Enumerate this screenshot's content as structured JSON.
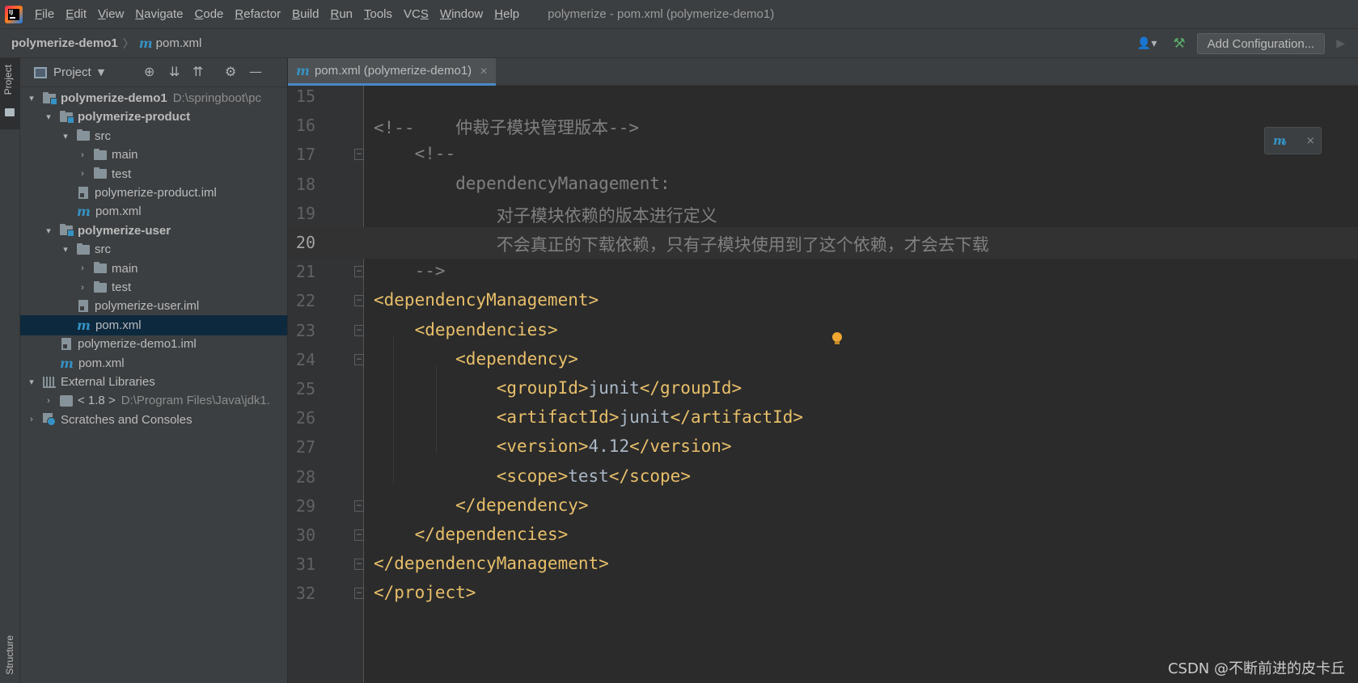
{
  "menubar": {
    "items": [
      {
        "label": "File",
        "mnemonic": "F",
        "rest": "ile"
      },
      {
        "label": "Edit",
        "mnemonic": "E",
        "rest": "dit"
      },
      {
        "label": "View",
        "mnemonic": "V",
        "rest": "iew"
      },
      {
        "label": "Navigate",
        "mnemonic": "N",
        "rest": "avigate"
      },
      {
        "label": "Code",
        "mnemonic": "C",
        "rest": "ode"
      },
      {
        "label": "Refactor",
        "mnemonic": "R",
        "rest": "efactor"
      },
      {
        "label": "Build",
        "mnemonic": "B",
        "rest": "uild"
      },
      {
        "label": "Run",
        "mnemonic": "R",
        "rest": "un"
      },
      {
        "label": "Tools",
        "mnemonic": "T",
        "rest": "ools"
      },
      {
        "label": "VCS",
        "mnemonic": "S",
        "rest": "VC"
      },
      {
        "label": "Window",
        "mnemonic": "W",
        "rest": "indow"
      },
      {
        "label": "Help",
        "mnemonic": "H",
        "rest": "elp"
      }
    ],
    "window_title": "polymerize - pom.xml (polymerize-demo1)"
  },
  "navbar": {
    "project": "polymerize-demo1",
    "separator": "〉",
    "file_icon": "m",
    "file": "pom.xml",
    "add_configuration": "Add Configuration..."
  },
  "left_strip": {
    "project_label": "Project",
    "structure_label": "Structure"
  },
  "project_panel": {
    "title": "Project",
    "tree": [
      {
        "label": "polymerize-demo1",
        "path": "D:\\springboot\\pc",
        "icon": "module-folder",
        "arrow": "▾",
        "bold": true
      },
      {
        "label": "polymerize-product",
        "icon": "module-folder",
        "arrow": "▾",
        "bold": true
      },
      {
        "label": "src",
        "icon": "folder",
        "arrow": "▾"
      },
      {
        "label": "main",
        "icon": "folder",
        "arrow": "›"
      },
      {
        "label": "test",
        "icon": "folder",
        "arrow": "›"
      },
      {
        "label": "polymerize-product.iml",
        "icon": "iml-file"
      },
      {
        "label": "pom.xml",
        "icon": "maven-file"
      },
      {
        "label": "polymerize-user",
        "icon": "module-folder",
        "arrow": "▾",
        "bold": true
      },
      {
        "label": "src",
        "icon": "folder",
        "arrow": "▾"
      },
      {
        "label": "main",
        "icon": "folder",
        "arrow": "›"
      },
      {
        "label": "test",
        "icon": "folder",
        "arrow": "›"
      },
      {
        "label": "polymerize-user.iml",
        "icon": "iml-file"
      },
      {
        "label": "pom.xml",
        "icon": "maven-file",
        "selected": true
      },
      {
        "label": "polymerize-demo1.iml",
        "icon": "iml-file"
      },
      {
        "label": "pom.xml",
        "icon": "maven-file"
      },
      {
        "label": "External Libraries",
        "icon": "library",
        "arrow": "▾"
      },
      {
        "label": "< 1.8 >",
        "path": "D:\\Program Files\\Java\\jdk1.",
        "icon": "jdk",
        "arrow": "›"
      },
      {
        "label": "Scratches and Consoles",
        "icon": "scratches",
        "arrow": "›"
      }
    ]
  },
  "editor": {
    "tab_icon": "m",
    "tab_label": "pom.xml (polymerize-demo1)",
    "current_line": 20,
    "lines": [
      {
        "num": "15",
        "text": ""
      },
      {
        "num": "16",
        "text": "<!--    仲裁子模块管理版本-->"
      },
      {
        "num": "17",
        "text": "    <!--"
      },
      {
        "num": "18",
        "text": "        dependencyManagement:"
      },
      {
        "num": "19",
        "text": "            对子模块依赖的版本进行定义"
      },
      {
        "num": "20",
        "text": "            不会真正的下载依赖，只有子模块使用到了这个依赖，才会去下载"
      },
      {
        "num": "21",
        "text": "    -->"
      },
      {
        "num": "22",
        "text": "<dependencyManagement>"
      },
      {
        "num": "23",
        "text": "    <dependencies>"
      },
      {
        "num": "24",
        "text": "        <dependency>"
      },
      {
        "num": "25",
        "text": "            <groupId>junit</groupId>"
      },
      {
        "num": "26",
        "text": "            <artifactId>junit</artifactId>"
      },
      {
        "num": "27",
        "text": "            <version>4.12</version>"
      },
      {
        "num": "28",
        "text": "            <scope>test</scope>"
      },
      {
        "num": "29",
        "text": "        </dependency>"
      },
      {
        "num": "30",
        "text": "    </dependencies>"
      },
      {
        "num": "31",
        "text": "</dependencyManagement>"
      },
      {
        "num": "32",
        "text": "</project>"
      }
    ]
  },
  "maven_popup": {
    "icon": "m",
    "close": "×"
  },
  "watermark": "CSDN @不断前进的皮卡丘",
  "colors": {
    "background": "#2b2b2b",
    "panel": "#3c3f41",
    "selection": "#0d293e",
    "xml_tag": "#e8bf6a",
    "comment": "#808080",
    "text": "#a9b7c6",
    "accent": "#3592c4"
  }
}
